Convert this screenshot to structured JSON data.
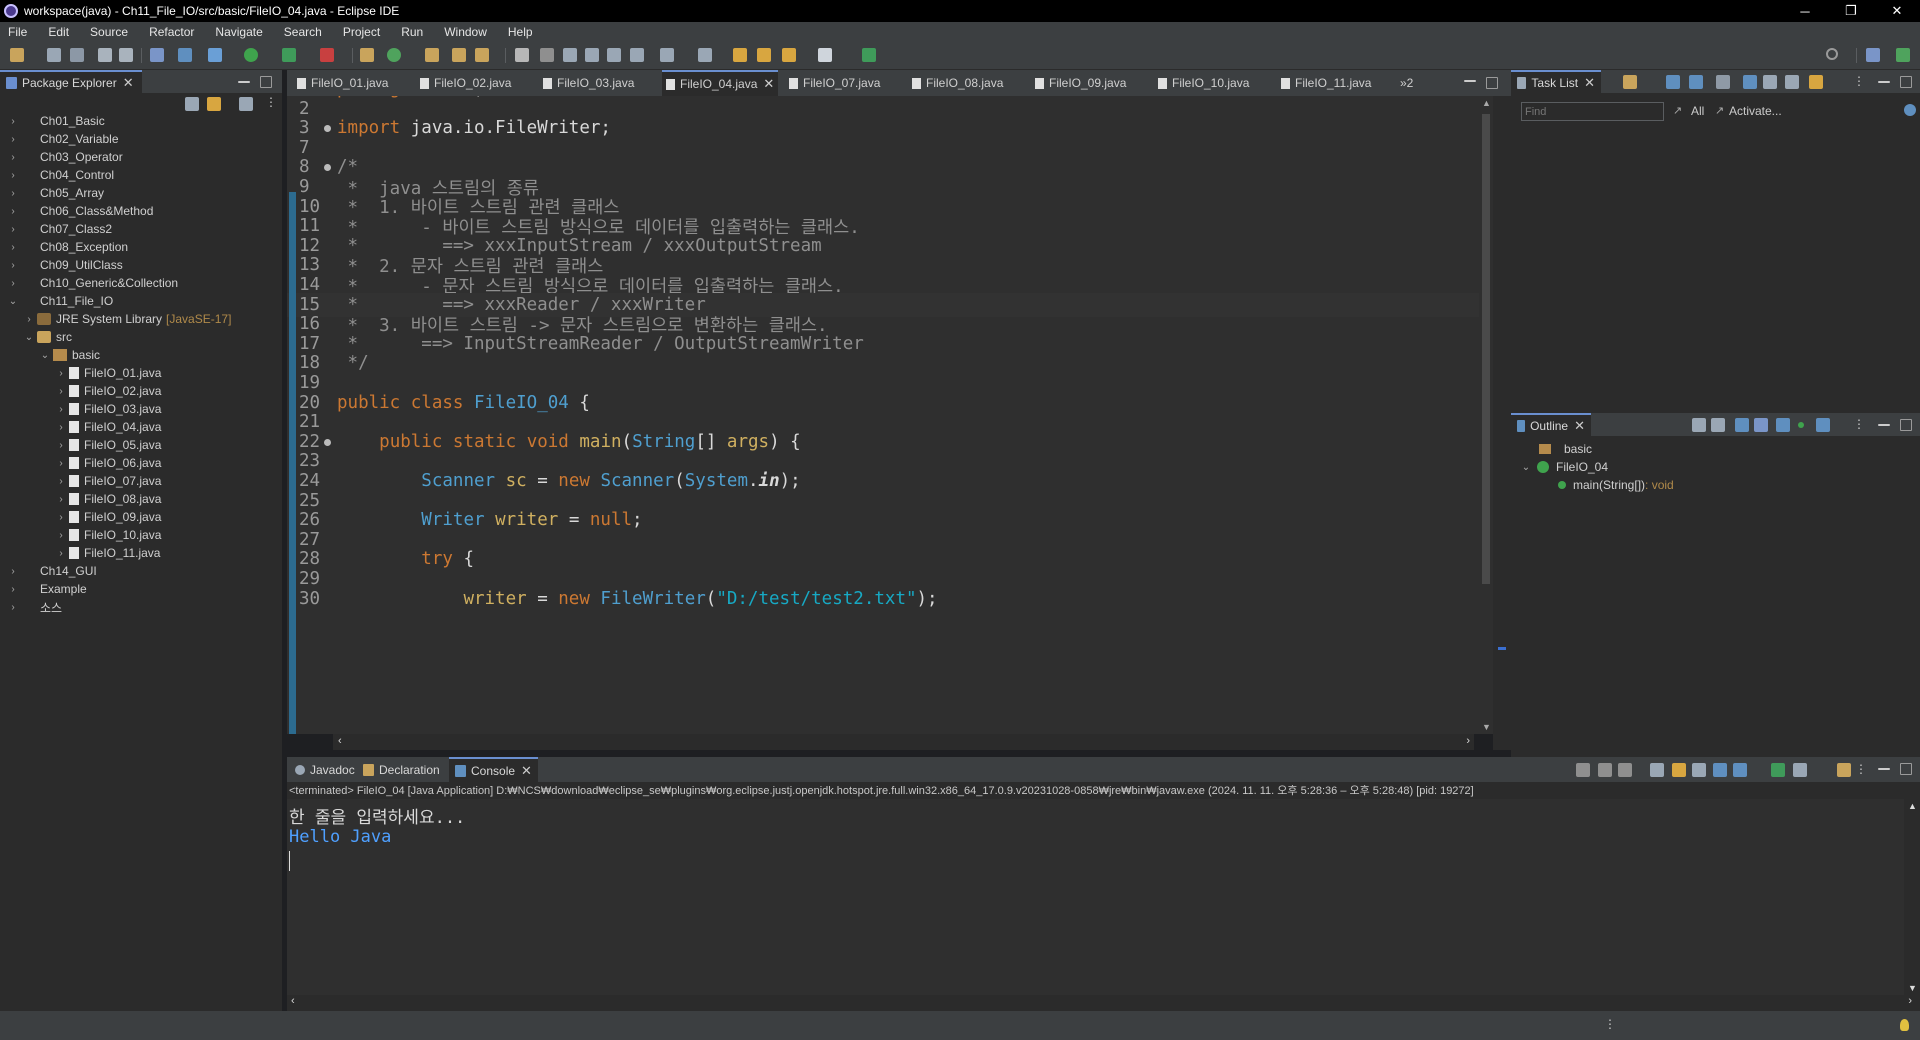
{
  "window": {
    "title": "workspace(java) - Ch11_File_IO/src/basic/FileIO_04.java - Eclipse IDE",
    "controls": [
      "─",
      "❐",
      "✕"
    ]
  },
  "menu": [
    "File",
    "Edit",
    "Source",
    "Refactor",
    "Navigate",
    "Search",
    "Project",
    "Run",
    "Window",
    "Help"
  ],
  "package_explorer": {
    "title": "Package Explorer",
    "items": [
      {
        "label": "Ch01_Basic",
        "type": "project",
        "expanded": false
      },
      {
        "label": "Ch02_Variable",
        "type": "project",
        "expanded": false
      },
      {
        "label": "Ch03_Operator",
        "type": "project",
        "expanded": false
      },
      {
        "label": "Ch04_Control",
        "type": "project",
        "expanded": false
      },
      {
        "label": "Ch05_Array",
        "type": "project",
        "expanded": false
      },
      {
        "label": "Ch06_Class&Method",
        "type": "project",
        "expanded": false
      },
      {
        "label": "Ch07_Class2",
        "type": "project",
        "expanded": false
      },
      {
        "label": "Ch08_Exception",
        "type": "project",
        "expanded": false
      },
      {
        "label": "Ch09_UtilClass",
        "type": "project",
        "expanded": false
      },
      {
        "label": "Ch10_Generic&Collection",
        "type": "project",
        "expanded": false
      },
      {
        "label": "Ch11_File_IO",
        "type": "project",
        "expanded": true
      },
      {
        "label": "JRE System Library",
        "extra": "[JavaSE-17]",
        "type": "lib",
        "expanded": false
      },
      {
        "label": "src",
        "type": "src",
        "expanded": true
      },
      {
        "label": "basic",
        "type": "pkg",
        "expanded": true
      },
      {
        "label": "FileIO_01.java",
        "type": "file"
      },
      {
        "label": "FileIO_02.java",
        "type": "file"
      },
      {
        "label": "FileIO_03.java",
        "type": "file"
      },
      {
        "label": "FileIO_04.java",
        "type": "file"
      },
      {
        "label": "FileIO_05.java",
        "type": "file"
      },
      {
        "label": "FileIO_06.java",
        "type": "file"
      },
      {
        "label": "FileIO_07.java",
        "type": "file"
      },
      {
        "label": "FileIO_08.java",
        "type": "file"
      },
      {
        "label": "FileIO_09.java",
        "type": "file"
      },
      {
        "label": "FileIO_10.java",
        "type": "file"
      },
      {
        "label": "FileIO_11.java",
        "type": "file"
      },
      {
        "label": "Ch14_GUI",
        "type": "project",
        "expanded": false
      },
      {
        "label": "Example",
        "type": "project",
        "expanded": false
      },
      {
        "label": "소스",
        "type": "project",
        "expanded": false
      }
    ]
  },
  "editor_tabs": [
    "FileIO_01.java",
    "FileIO_02.java",
    "FileIO_03.java",
    "FileIO_04.java",
    "FileIO_07.java",
    "FileIO_08.java",
    "FileIO_09.java",
    "FileIO_10.java",
    "FileIO_11.java"
  ],
  "editor_active_tab": "FileIO_04.java",
  "editor_overflow": "»2",
  "code_lines": [
    {
      "n": "1",
      "t": "package basic;"
    },
    {
      "n": "2",
      "t": ""
    },
    {
      "n": "3",
      "t": "import java.io.FileWriter;"
    },
    {
      "n": "7",
      "t": ""
    },
    {
      "n": "8",
      "t": "/*"
    },
    {
      "n": "9",
      "t": " *  java 스트림의 종류"
    },
    {
      "n": "10",
      "t": " *  1. 바이트 스트림 관련 클래스"
    },
    {
      "n": "11",
      "t": " *      - 바이트 스트림 방식으로 데이터를 입출력하는 클래스."
    },
    {
      "n": "12",
      "t": " *        ==> xxxInputStream / xxxOutputStream"
    },
    {
      "n": "13",
      "t": " *  2. 문자 스트림 관련 클래스"
    },
    {
      "n": "14",
      "t": " *      - 문자 스트림 방식으로 데이터를 입출력하는 클래스."
    },
    {
      "n": "15",
      "t": " *        ==> xxxReader / xxxWriter"
    },
    {
      "n": "16",
      "t": " *  3. 바이트 스트림 -> 문자 스트림으로 변환하는 클래스."
    },
    {
      "n": "17",
      "t": " *      ==> InputStreamReader / OutputStreamWriter"
    },
    {
      "n": "18",
      "t": " */"
    },
    {
      "n": "19",
      "t": ""
    },
    {
      "n": "20",
      "t": "public class FileIO_04 {"
    },
    {
      "n": "21",
      "t": ""
    },
    {
      "n": "22",
      "t": "    public static void main(String[] args) {"
    },
    {
      "n": "23",
      "t": ""
    },
    {
      "n": "24",
      "t": "        Scanner sc = new Scanner(System.in);"
    },
    {
      "n": "25",
      "t": ""
    },
    {
      "n": "26",
      "t": "        Writer writer = null;"
    },
    {
      "n": "27",
      "t": ""
    },
    {
      "n": "28",
      "t": "        try {"
    },
    {
      "n": "29",
      "t": ""
    },
    {
      "n": "30",
      "t": "            writer = new FileWriter(\"D:/test/test2.txt\");"
    }
  ],
  "task_list": {
    "title": "Task List",
    "find_placeholder": "Find",
    "all_label": "All",
    "activate_label": "Activate..."
  },
  "outline": {
    "title": "Outline",
    "items": [
      {
        "label": "basic"
      },
      {
        "label": "FileIO_04"
      },
      {
        "label": "main(String[])",
        "suffix": " : void"
      }
    ]
  },
  "bottom_tabs": [
    "Javadoc",
    "Declaration",
    "Console"
  ],
  "bottom_active_tab": "Console",
  "console": {
    "header": "<terminated> FileIO_04 [Java Application] D:₩NCS₩download₩eclipse_se₩plugins₩org.eclipse.justj.openjdk.hotspot.jre.full.win32.x86_64_17.0.9.v20231028-0858₩jre₩bin₩javaw.exe  (2024. 11. 11. 오후 5:28:36 – 오후 5:28:48) [pid: 19272]",
    "lines": [
      "한 줄을 입력하세요...",
      "Hello Java"
    ]
  },
  "colors": {
    "accent": "#6a8fd0",
    "keyword": "#cc7832",
    "comment": "#8f8f8f",
    "type": "#4f9fcf",
    "method": "#d0b060",
    "string": "#17a9c4"
  }
}
